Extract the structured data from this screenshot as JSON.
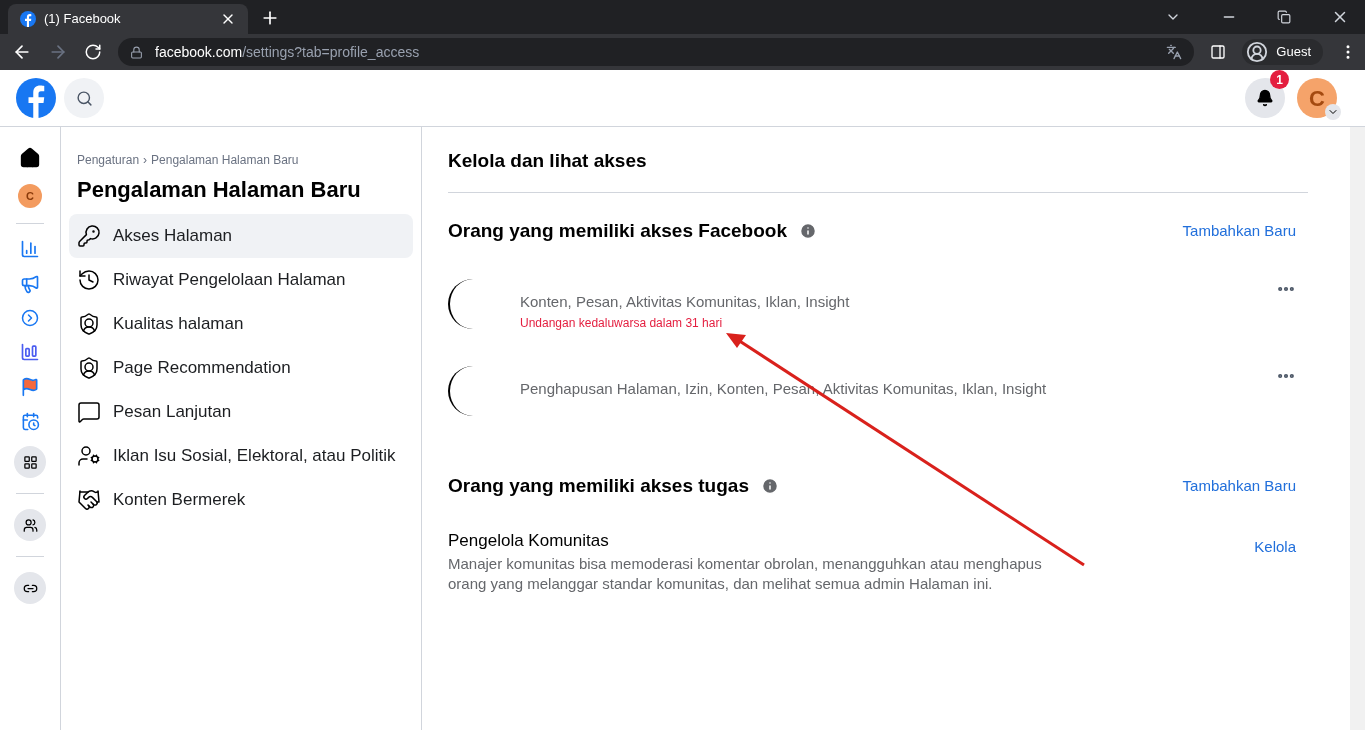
{
  "browser": {
    "tab_title": "(1) Facebook",
    "url_domain": "facebook.com",
    "url_path": "/settings?tab=profile_access",
    "profile": "Guest"
  },
  "header": {
    "notification_count": "1",
    "avatar_letter": "C"
  },
  "rail": {
    "avatar_letter": "C"
  },
  "sidebar": {
    "breadcrumb": [
      "Pengaturan",
      "Pengalaman Halaman Baru"
    ],
    "breadcrumb_separator": "›",
    "title": "Pengalaman Halaman Baru",
    "items": [
      {
        "kind": "key",
        "label": "Akses Halaman",
        "selected": true
      },
      {
        "kind": "history",
        "label": "Riwayat Pengelolaan Halaman",
        "selected": false
      },
      {
        "kind": "shield",
        "label": "Kualitas halaman",
        "selected": false
      },
      {
        "kind": "shield",
        "label": "Page Recommendation",
        "selected": false
      },
      {
        "kind": "chat",
        "label": "Pesan Lanjutan",
        "selected": false
      },
      {
        "kind": "person-gear",
        "label": "Iklan Isu Sosial, Elektoral, atau Politik",
        "selected": false
      },
      {
        "kind": "handshake",
        "label": "Konten Bermerek",
        "selected": false
      }
    ]
  },
  "main": {
    "title": "Kelola dan lihat akses",
    "facebook_access": {
      "heading": "Orang yang memiliki akses Facebook",
      "action": "Tambahkan Baru",
      "people": [
        {
          "permissions": "Konten, Pesan, Aktivitas Komunitas, Iklan, Insight",
          "note": "Undangan kedaluwarsa dalam 31 hari"
        },
        {
          "permissions": "Penghapusan Halaman, Izin, Konten, Pesan, Aktivitas Komunitas, Iklan, Insight"
        }
      ]
    },
    "task_access": {
      "heading": "Orang yang memiliki akses tugas",
      "action": "Tambahkan Baru",
      "roles": [
        {
          "title": "Pengelola Komunitas",
          "description": "Manajer komunitas bisa memoderasi komentar obrolan, menangguhkan atau menghapus orang yang melanggar standar komunitas, dan melihat semua admin Halaman ini.",
          "action": "Kelola"
        }
      ]
    }
  }
}
